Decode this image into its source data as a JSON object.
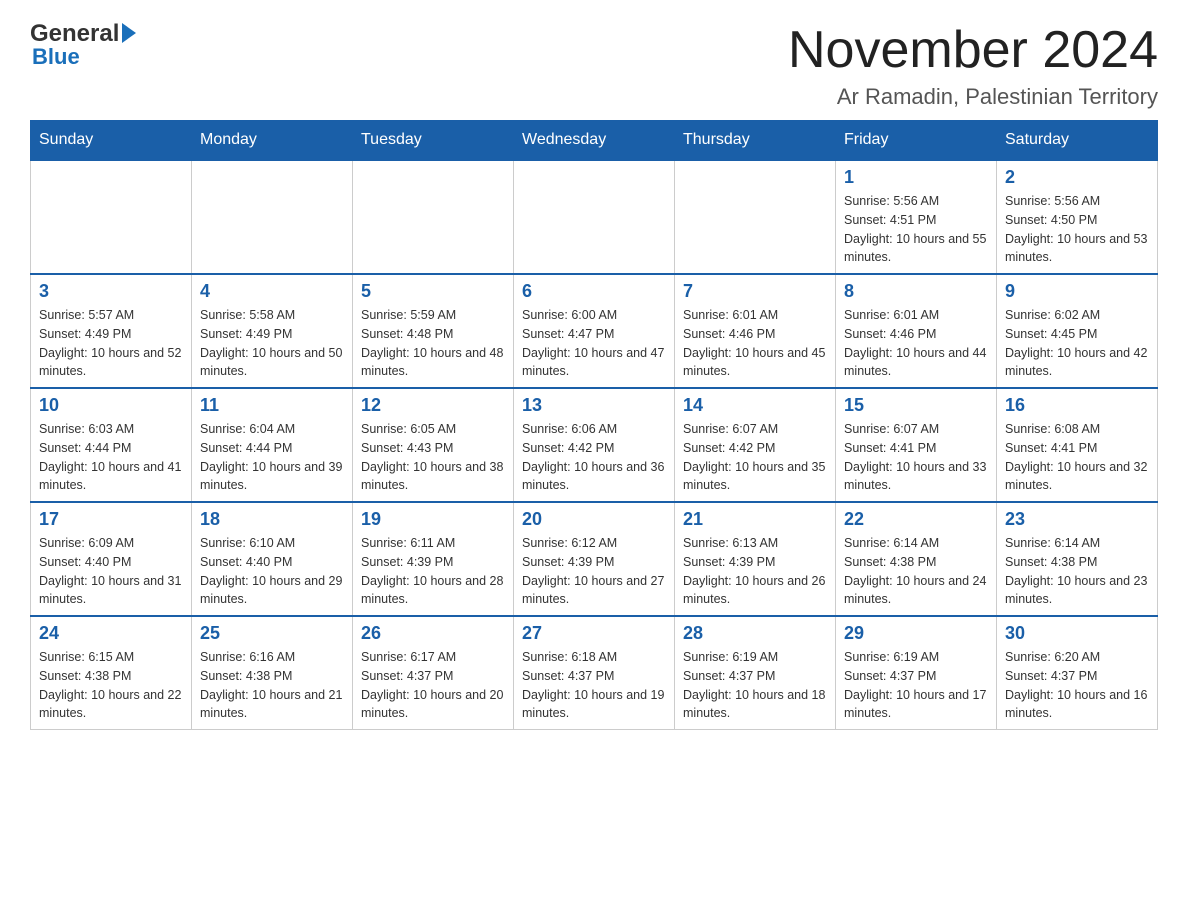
{
  "header": {
    "logo_general": "General",
    "logo_blue": "Blue",
    "title": "November 2024",
    "location": "Ar Ramadin, Palestinian Territory"
  },
  "days_of_week": [
    "Sunday",
    "Monday",
    "Tuesday",
    "Wednesday",
    "Thursday",
    "Friday",
    "Saturday"
  ],
  "weeks": [
    [
      {
        "day": "",
        "sunrise": "",
        "sunset": "",
        "daylight": ""
      },
      {
        "day": "",
        "sunrise": "",
        "sunset": "",
        "daylight": ""
      },
      {
        "day": "",
        "sunrise": "",
        "sunset": "",
        "daylight": ""
      },
      {
        "day": "",
        "sunrise": "",
        "sunset": "",
        "daylight": ""
      },
      {
        "day": "",
        "sunrise": "",
        "sunset": "",
        "daylight": ""
      },
      {
        "day": "1",
        "sunrise": "Sunrise: 5:56 AM",
        "sunset": "Sunset: 4:51 PM",
        "daylight": "Daylight: 10 hours and 55 minutes."
      },
      {
        "day": "2",
        "sunrise": "Sunrise: 5:56 AM",
        "sunset": "Sunset: 4:50 PM",
        "daylight": "Daylight: 10 hours and 53 minutes."
      }
    ],
    [
      {
        "day": "3",
        "sunrise": "Sunrise: 5:57 AM",
        "sunset": "Sunset: 4:49 PM",
        "daylight": "Daylight: 10 hours and 52 minutes."
      },
      {
        "day": "4",
        "sunrise": "Sunrise: 5:58 AM",
        "sunset": "Sunset: 4:49 PM",
        "daylight": "Daylight: 10 hours and 50 minutes."
      },
      {
        "day": "5",
        "sunrise": "Sunrise: 5:59 AM",
        "sunset": "Sunset: 4:48 PM",
        "daylight": "Daylight: 10 hours and 48 minutes."
      },
      {
        "day": "6",
        "sunrise": "Sunrise: 6:00 AM",
        "sunset": "Sunset: 4:47 PM",
        "daylight": "Daylight: 10 hours and 47 minutes."
      },
      {
        "day": "7",
        "sunrise": "Sunrise: 6:01 AM",
        "sunset": "Sunset: 4:46 PM",
        "daylight": "Daylight: 10 hours and 45 minutes."
      },
      {
        "day": "8",
        "sunrise": "Sunrise: 6:01 AM",
        "sunset": "Sunset: 4:46 PM",
        "daylight": "Daylight: 10 hours and 44 minutes."
      },
      {
        "day": "9",
        "sunrise": "Sunrise: 6:02 AM",
        "sunset": "Sunset: 4:45 PM",
        "daylight": "Daylight: 10 hours and 42 minutes."
      }
    ],
    [
      {
        "day": "10",
        "sunrise": "Sunrise: 6:03 AM",
        "sunset": "Sunset: 4:44 PM",
        "daylight": "Daylight: 10 hours and 41 minutes."
      },
      {
        "day": "11",
        "sunrise": "Sunrise: 6:04 AM",
        "sunset": "Sunset: 4:44 PM",
        "daylight": "Daylight: 10 hours and 39 minutes."
      },
      {
        "day": "12",
        "sunrise": "Sunrise: 6:05 AM",
        "sunset": "Sunset: 4:43 PM",
        "daylight": "Daylight: 10 hours and 38 minutes."
      },
      {
        "day": "13",
        "sunrise": "Sunrise: 6:06 AM",
        "sunset": "Sunset: 4:42 PM",
        "daylight": "Daylight: 10 hours and 36 minutes."
      },
      {
        "day": "14",
        "sunrise": "Sunrise: 6:07 AM",
        "sunset": "Sunset: 4:42 PM",
        "daylight": "Daylight: 10 hours and 35 minutes."
      },
      {
        "day": "15",
        "sunrise": "Sunrise: 6:07 AM",
        "sunset": "Sunset: 4:41 PM",
        "daylight": "Daylight: 10 hours and 33 minutes."
      },
      {
        "day": "16",
        "sunrise": "Sunrise: 6:08 AM",
        "sunset": "Sunset: 4:41 PM",
        "daylight": "Daylight: 10 hours and 32 minutes."
      }
    ],
    [
      {
        "day": "17",
        "sunrise": "Sunrise: 6:09 AM",
        "sunset": "Sunset: 4:40 PM",
        "daylight": "Daylight: 10 hours and 31 minutes."
      },
      {
        "day": "18",
        "sunrise": "Sunrise: 6:10 AM",
        "sunset": "Sunset: 4:40 PM",
        "daylight": "Daylight: 10 hours and 29 minutes."
      },
      {
        "day": "19",
        "sunrise": "Sunrise: 6:11 AM",
        "sunset": "Sunset: 4:39 PM",
        "daylight": "Daylight: 10 hours and 28 minutes."
      },
      {
        "day": "20",
        "sunrise": "Sunrise: 6:12 AM",
        "sunset": "Sunset: 4:39 PM",
        "daylight": "Daylight: 10 hours and 27 minutes."
      },
      {
        "day": "21",
        "sunrise": "Sunrise: 6:13 AM",
        "sunset": "Sunset: 4:39 PM",
        "daylight": "Daylight: 10 hours and 26 minutes."
      },
      {
        "day": "22",
        "sunrise": "Sunrise: 6:14 AM",
        "sunset": "Sunset: 4:38 PM",
        "daylight": "Daylight: 10 hours and 24 minutes."
      },
      {
        "day": "23",
        "sunrise": "Sunrise: 6:14 AM",
        "sunset": "Sunset: 4:38 PM",
        "daylight": "Daylight: 10 hours and 23 minutes."
      }
    ],
    [
      {
        "day": "24",
        "sunrise": "Sunrise: 6:15 AM",
        "sunset": "Sunset: 4:38 PM",
        "daylight": "Daylight: 10 hours and 22 minutes."
      },
      {
        "day": "25",
        "sunrise": "Sunrise: 6:16 AM",
        "sunset": "Sunset: 4:38 PM",
        "daylight": "Daylight: 10 hours and 21 minutes."
      },
      {
        "day": "26",
        "sunrise": "Sunrise: 6:17 AM",
        "sunset": "Sunset: 4:37 PM",
        "daylight": "Daylight: 10 hours and 20 minutes."
      },
      {
        "day": "27",
        "sunrise": "Sunrise: 6:18 AM",
        "sunset": "Sunset: 4:37 PM",
        "daylight": "Daylight: 10 hours and 19 minutes."
      },
      {
        "day": "28",
        "sunrise": "Sunrise: 6:19 AM",
        "sunset": "Sunset: 4:37 PM",
        "daylight": "Daylight: 10 hours and 18 minutes."
      },
      {
        "day": "29",
        "sunrise": "Sunrise: 6:19 AM",
        "sunset": "Sunset: 4:37 PM",
        "daylight": "Daylight: 10 hours and 17 minutes."
      },
      {
        "day": "30",
        "sunrise": "Sunrise: 6:20 AM",
        "sunset": "Sunset: 4:37 PM",
        "daylight": "Daylight: 10 hours and 16 minutes."
      }
    ]
  ]
}
